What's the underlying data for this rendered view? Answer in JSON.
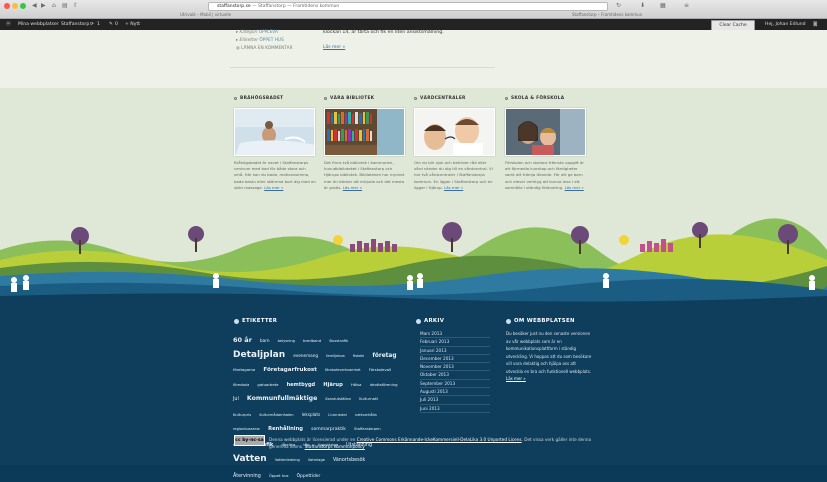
{
  "browser": {
    "url_domain": "staffanstorp.se",
    "url_rest": "— Staffanstorp — Framtidens kommun",
    "tab_left": "Utrivaló – Mobil | virtuelle",
    "tab_right": "Staffanstorp – Framtidens kommun"
  },
  "wpbar": {
    "my_sites": "Mina webbplatser",
    "site_name": "Staffanstorp",
    "updates": "1",
    "comments": "0",
    "new": "+ Nytt",
    "greeting": "Hej, Johan Edlund",
    "clear_cache": "Clear Cache"
  },
  "post": {
    "category_label": "Kategori",
    "category_value": "UPPLEVA",
    "tags_label": "Etiketter",
    "tags_value": "ÖPPET HUS",
    "comment_link": "LÄMNA EN KOMMENTAR",
    "body_text": "klockan 14, är tårta och fik en liten ansiktsmålning.",
    "read_more": "Läs mer »"
  },
  "columns": [
    {
      "title": "BRÅHÖGSBADET",
      "text": "Bråhögsbadet är navet i Staffanstorps centrum med bad för både stora och små. Här kan du bada, motionssimma, bada bastu eller skämma bort dig med en skön massage.",
      "link": "Läs mer »"
    },
    {
      "title": "VÅRA BIBLIOTEK",
      "text": "Det finns två bibliotek i kommunen, huvudbiblioteket i Staffanstorp och Hjärups bibliotek. Biblioteken har mycket mer än böcker att erbjuda och det mesta är gratis.",
      "link": "Läs mer »"
    },
    {
      "title": "VÅRDCENTRALER",
      "text": "Om du blir sjuk och behöver råd eller vård vänder du dig till en vårdcentral. Vi har två vårdcentraler i Staffanstorps kommun. En ligger i Staffanstorp och en ligger i Hjärup.",
      "link": "Läs mer »"
    },
    {
      "title": "SKOLA & FÖRSKOLA",
      "text": "Förskolan och skolans främsta uppgift är att förmedla kunskap och färdigheter samt att främja lärande. För att ge barn och elever verktyg att kunna leva i ett samhälle i ständig förändring.",
      "link": "Läs mer »"
    }
  ],
  "footer": {
    "tags_title": "ETIKETTER",
    "tags": [
      {
        "t": "60 år",
        "s": 6.5
      },
      {
        "t": "barn",
        "s": 4.2
      },
      {
        "t": "belysning",
        "s": 3.6
      },
      {
        "t": "bredband",
        "s": 3.8
      },
      {
        "t": "Busstrafik",
        "s": 3.8
      },
      {
        "t": "Detaljplan",
        "s": 9
      },
      {
        "t": "evenemang",
        "s": 4.2
      },
      {
        "t": "familjebus",
        "s": 3.6
      },
      {
        "t": "fiskeki",
        "s": 3.6
      },
      {
        "t": "företag",
        "s": 5.8
      },
      {
        "t": "företagarna",
        "s": 3.8
      },
      {
        "t": "Företagarfrukost",
        "s": 5.6
      },
      {
        "t": "förskoleverksamhet",
        "s": 3.6
      },
      {
        "t": "Förskolevall",
        "s": 3.8
      },
      {
        "t": "föreskola",
        "s": 3.6
      },
      {
        "t": "gatuarbete",
        "s": 3.8
      },
      {
        "t": "hemtbygd",
        "s": 5
      },
      {
        "t": "Hjärup",
        "s": 5.2
      },
      {
        "t": "Hälsa",
        "s": 3.8
      },
      {
        "t": "idrottsförening",
        "s": 3.8
      },
      {
        "t": "Jul",
        "s": 4.8
      },
      {
        "t": "Kommunfullmäktige",
        "s": 6.2
      },
      {
        "t": "Konstutställan",
        "s": 3.6
      },
      {
        "t": "Kulturnatt",
        "s": 3.8
      },
      {
        "t": "Kulturpris",
        "s": 3.8
      },
      {
        "t": "Kulturmådamhalen",
        "s": 3.6
      },
      {
        "t": "leksplats",
        "s": 4.2
      },
      {
        "t": "Liunnedal",
        "s": 3.8
      },
      {
        "t": "nattvarhålla",
        "s": 3.6
      },
      {
        "t": "regionbusserar",
        "s": 3.6
      },
      {
        "t": "Renhållning",
        "s": 5.2
      },
      {
        "t": "sommarpraktik",
        "s": 4.6
      },
      {
        "t": "Staffanstorpen",
        "s": 3.6
      },
      {
        "t": "säkerhet",
        "s": 3.8
      },
      {
        "t": "trafik",
        "s": 5.2
      },
      {
        "t": "tåreling",
        "s": 3.6
      },
      {
        "t": "tåg",
        "s": 3.8
      },
      {
        "t": "Uppsläring",
        "s": 3.8
      },
      {
        "t": "Utställning",
        "s": 4.8
      },
      {
        "t": "Vatten",
        "s": 9
      },
      {
        "t": "Vattenledning",
        "s": 3.6
      },
      {
        "t": "Vatmlage",
        "s": 3.6
      },
      {
        "t": "Vänortsbesök",
        "s": 4.8
      },
      {
        "t": "Återvinning",
        "s": 4.8
      },
      {
        "t": "Öppet hus",
        "s": 3.8
      },
      {
        "t": "Öppettider",
        "s": 4.4
      }
    ],
    "archive_title": "ARKIV",
    "archive": [
      "Mars 2013",
      "Februari 2013",
      "Januari 2013",
      "December 2013",
      "November 2013",
      "Oktober 2013",
      "September 2013",
      "Augusti 2013",
      "Juli 2013",
      "Juni 2013"
    ],
    "about_title": "OM WEBBPLATSEN",
    "about_text": "Du besöker just nu den senaste versionen av vår webbplats som är en kommunikationsplattform i ständig utveckling. Vi hoppas att du som besökare vill vara delaktig och hjälpa oss att utveckla en bra och funktionell webbplats.",
    "about_link": "Läs mer »",
    "license_pre": "Denna webbplats är licensierad under en",
    "license_link": "Creative Commons Erkännande-IckeKommersiell-DelaLika 3.0 Unported Licens",
    "license_post": ". Det vissa verk gäller inte denna generella licens.",
    "license_link2": "Staffanstorps Kommunpolicy",
    "cc_badge": "cc by-nc-sa"
  },
  "colors": {
    "footer_bg": "#0f3d5c",
    "mid_bg": "#dfe7d6",
    "top_bg": "#eef1e8",
    "accent_link": "#3b6e9c"
  }
}
